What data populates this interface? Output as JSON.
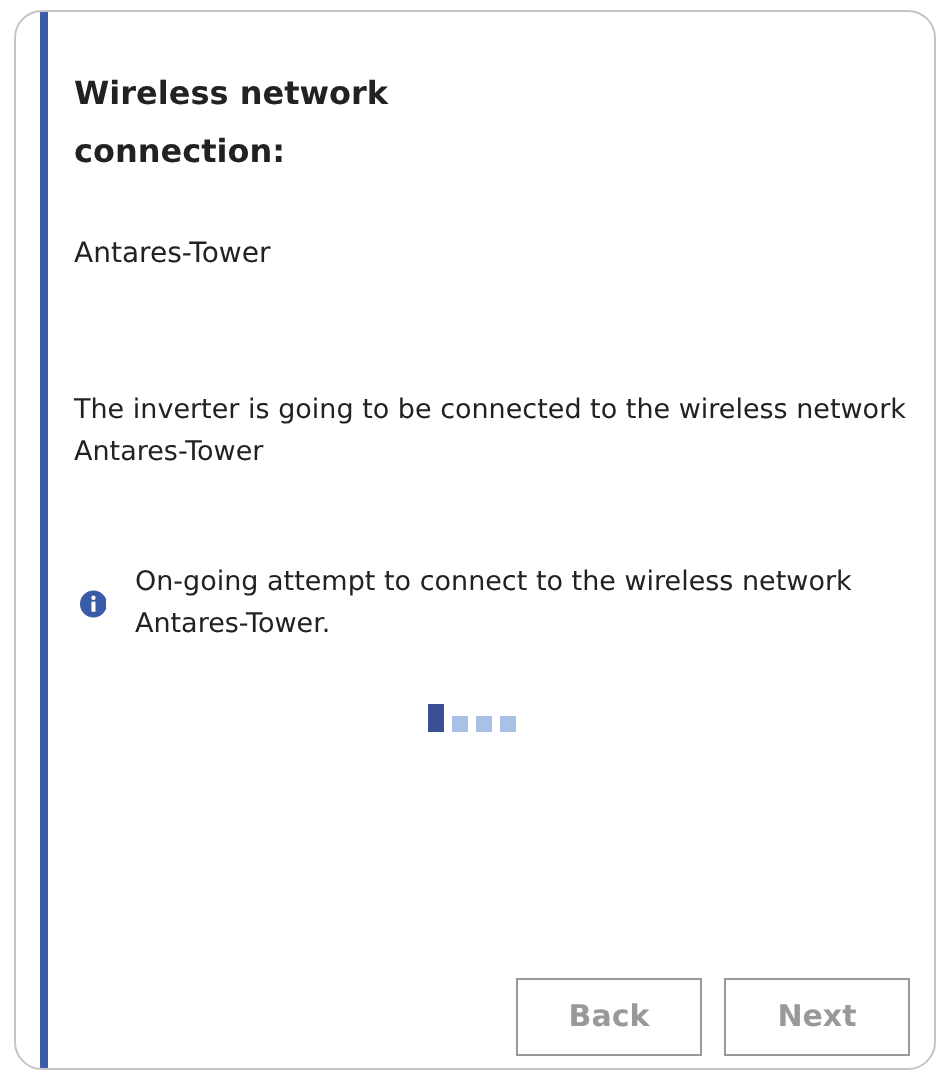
{
  "title": "Wireless network connection:",
  "network_name": "Antares-Tower",
  "description": "The inverter is going to be connected to the wireless network Antares-Tower",
  "info": {
    "text": "On-going attempt to connect to the wireless network Antares-Tower."
  },
  "loader_steps": [
    {
      "on": true
    },
    {
      "on": false
    },
    {
      "on": false
    },
    {
      "on": false
    }
  ],
  "buttons": [
    {
      "label": "Back",
      "disabled": true
    },
    {
      "label": "Next",
      "disabled": true
    }
  ]
}
